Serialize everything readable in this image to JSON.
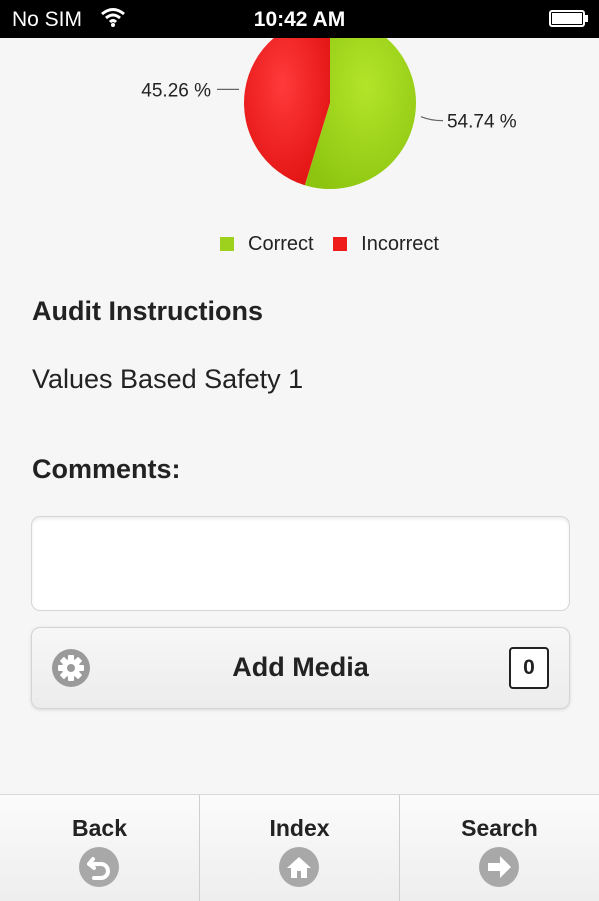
{
  "status_bar": {
    "carrier": "No SIM",
    "time": "10:42 AM"
  },
  "chart_data": {
    "type": "pie",
    "slices": [
      {
        "name": "Correct",
        "value": 54.74,
        "label": "54.74 %",
        "color": "#9ed11d"
      },
      {
        "name": "Incorrect",
        "value": 45.26,
        "label": "45.26 %",
        "color": "#ef1b1b"
      }
    ],
    "legend_position": "bottom"
  },
  "audit": {
    "heading": "Audit Instructions",
    "text": "Values Based Safety 1"
  },
  "comments": {
    "heading": "Comments:",
    "value": ""
  },
  "media": {
    "label": "Add Media",
    "count": "0",
    "icon": "gear-icon"
  },
  "tabs": [
    {
      "label": "Back",
      "icon": "back-arrow-icon"
    },
    {
      "label": "Index",
      "icon": "home-icon"
    },
    {
      "label": "Search",
      "icon": "forward-arrow-icon"
    }
  ]
}
